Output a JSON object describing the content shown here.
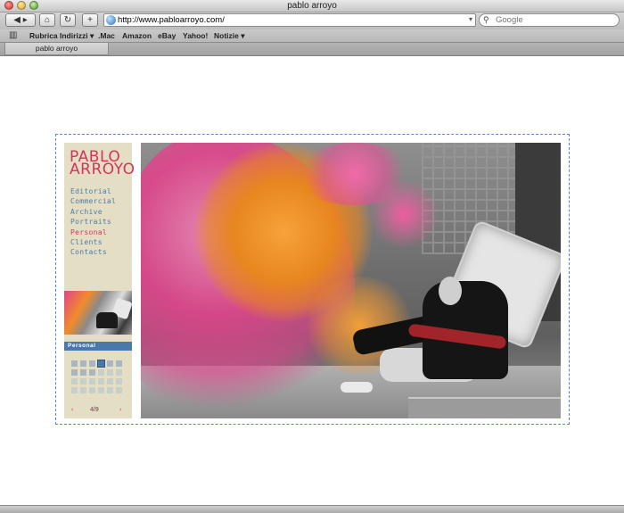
{
  "window": {
    "title": "pablo arroyo"
  },
  "toolbar": {
    "back_icon": "◀ ▸",
    "home_icon": "⌂",
    "reload_icon": "↻",
    "add_icon": "+",
    "url": "http://www.pabloarroyo.com/",
    "search_placeholder": "Google"
  },
  "bookmarks": {
    "book_icon": "📖",
    "items": [
      "Rubrica Indirizzi ▾",
      ".Mac",
      "Amazon",
      "eBay",
      "Yahoo!",
      "Notizie ▾"
    ]
  },
  "tabs": [
    {
      "label": "pablo arroyo"
    }
  ],
  "site": {
    "logo_line1": "PABLO",
    "logo_line2": "ARROYO",
    "nav": [
      "Editorial",
      "Commercial",
      "Archive",
      "Portraits",
      "Personal",
      "Clients",
      "Contacts"
    ],
    "active_nav": "Personal",
    "section_title": "Personal",
    "pager": {
      "prev": "‹",
      "count": "4/9",
      "next": "›"
    }
  },
  "colors": {
    "accent_pink": "#d5335a",
    "nav_blue": "#4d7aa8",
    "sidebar_bg": "#e4dfc4",
    "section_bar": "#4a78aa"
  }
}
